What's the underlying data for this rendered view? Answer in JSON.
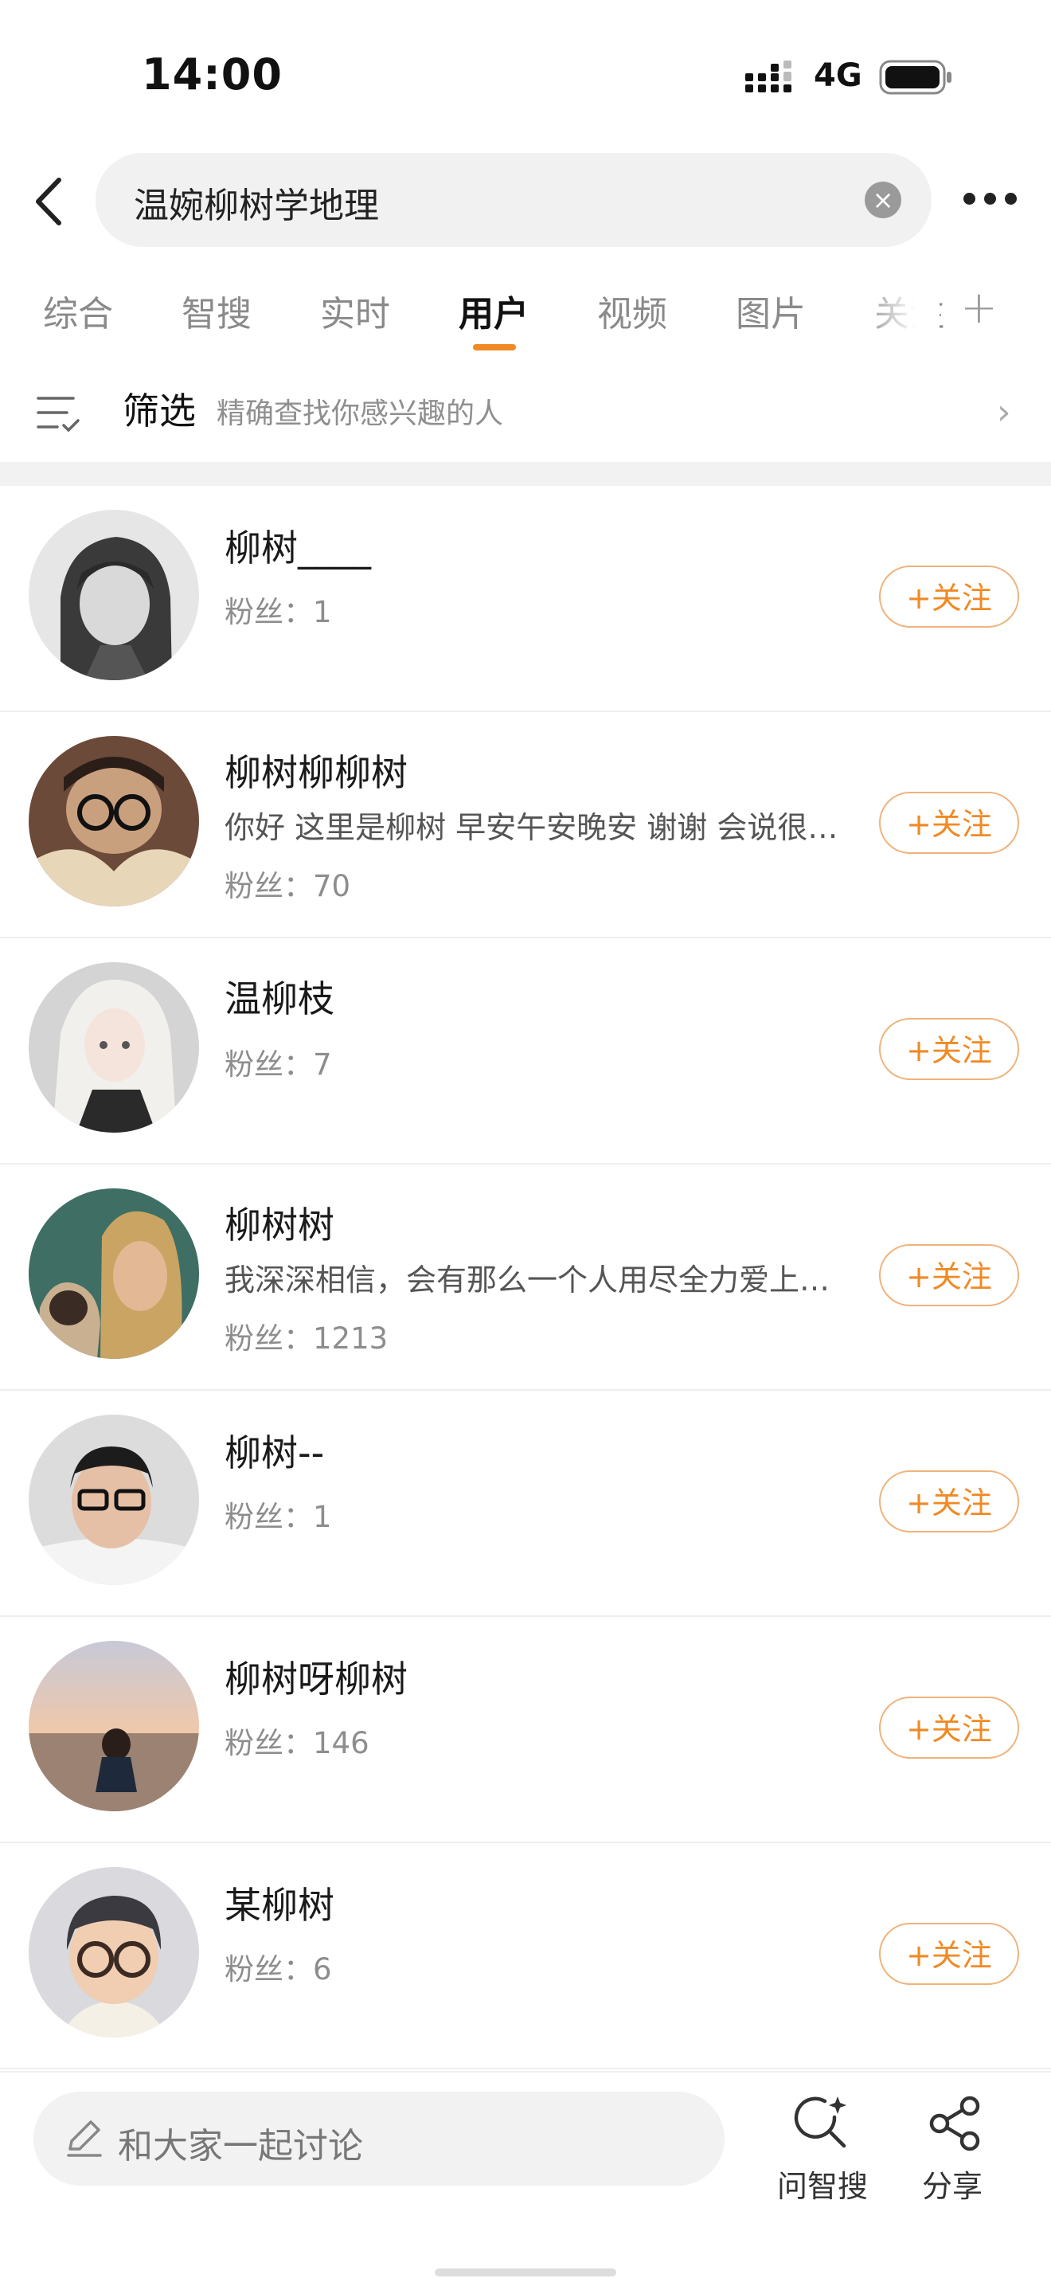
{
  "status_bar": {
    "time": "14:00",
    "network": "4G"
  },
  "search": {
    "query": "温婉柳树学地理",
    "clear_icon": "close-icon",
    "more_icon": "more-icon"
  },
  "tabs": [
    {
      "label": "综合",
      "active": false
    },
    {
      "label": "智搜",
      "active": false
    },
    {
      "label": "实时",
      "active": false
    },
    {
      "label": "用户",
      "active": true
    },
    {
      "label": "视频",
      "active": false
    },
    {
      "label": "图片",
      "active": false
    },
    {
      "label": "关注",
      "active": false
    }
  ],
  "filter": {
    "label": "筛选",
    "description": "精确查找你感兴趣的人"
  },
  "follow_label": "+关注",
  "users": [
    {
      "name": "柳树____",
      "bio": "",
      "fans": "粉丝：1",
      "avatar": "grayscale-anime-girl"
    },
    {
      "name": "柳树柳柳树",
      "bio": "你好 这里是柳树 早安午安晚安 谢谢 会说很…",
      "fans": "粉丝：70",
      "avatar": "reading-with-glasses"
    },
    {
      "name": "温柳枝",
      "bio": "",
      "fans": "粉丝：7",
      "avatar": "white-haired-doll"
    },
    {
      "name": "柳树树",
      "bio": "我深深相信，会有那么一个人用尽全力爱上…",
      "fans": "粉丝：1213",
      "avatar": "blond-man-with-cat"
    },
    {
      "name": "柳树--",
      "bio": "",
      "fans": "粉丝：1",
      "avatar": "man-with-glasses"
    },
    {
      "name": "柳树呀柳树",
      "bio": "",
      "fans": "粉丝：146",
      "avatar": "beach-sunset-person"
    },
    {
      "name": "某柳树",
      "bio": "",
      "fans": "粉丝：6",
      "avatar": "cartoon-boy-glasses"
    }
  ],
  "bottom_bar": {
    "comment_placeholder": "和大家一起讨论",
    "ask_label": "问智搜",
    "share_label": "分享"
  },
  "colors": {
    "accent": "#f08a24",
    "follow_border": "#f0b27a"
  }
}
